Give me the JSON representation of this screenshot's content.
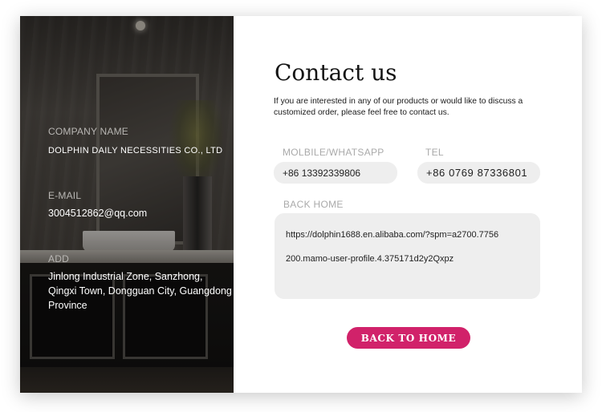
{
  "sidebar": {
    "company_label": "COMPANY NAME",
    "company_value": "DOLPHIN  DAILY NECESSITIES  CO., LTD",
    "email_label": "E-MAIL",
    "email_value": "3004512862@qq.com",
    "address_label": "ADD",
    "address_value": "Jinlong Industrial Zone, Sanzhong, Qingxi Town, Dongguan City, Guangdong Province"
  },
  "main": {
    "title": "Contact us",
    "intro": "If you are interested in any of our products or would like to discuss a customized order, please feel free to contact us.",
    "phone_label": "MOLBILE/WHATSAPP",
    "phone_value": "+86 13392339806",
    "tel_label": "TEL",
    "tel_value": "+86 0769 87336801",
    "back_home_label": "BACK HOME",
    "back_home_url_line1": "https://dolphin1688.en.alibaba.com/?spm=a2700.7756",
    "back_home_url_line2": "200.mamo-user-profile.4.375171d2y2Qxpz",
    "button_label": "BACK TO HOME"
  },
  "colors": {
    "accent": "#d1226a",
    "field_background": "#eeeeee",
    "label_gray": "#aaaaaa"
  }
}
